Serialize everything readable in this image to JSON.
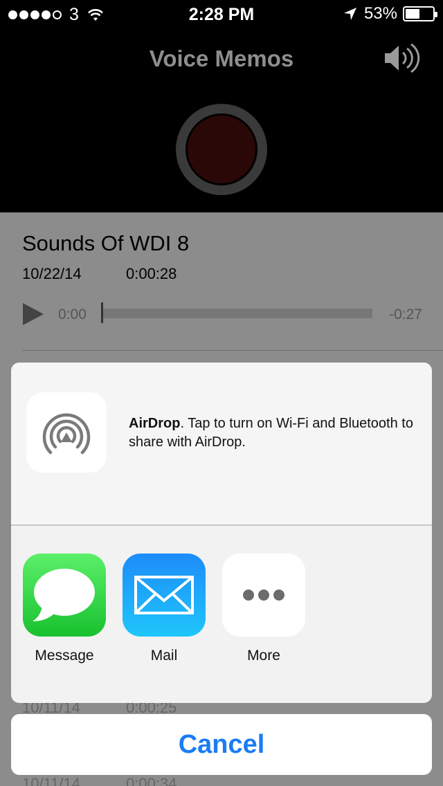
{
  "status_bar": {
    "carrier": "3",
    "time": "2:28 PM",
    "battery_percent": "53%",
    "battery_level": 0.53
  },
  "header": {
    "title": "Voice Memos"
  },
  "recording": {
    "name": "Sounds Of WDI 8",
    "date": "10/22/14",
    "duration": "0:00:28",
    "current_time": "0:00",
    "remaining_time": "-0:27",
    "progress": 0
  },
  "background_rows": [
    {
      "date": "10/11/14",
      "duration": "0:00:25"
    },
    {
      "date": "10/11/14",
      "duration": "0:00:34"
    }
  ],
  "share_sheet": {
    "airdrop_title": "AirDrop",
    "airdrop_text": ". Tap to turn on Wi-Fi and Bluetooth to share with AirDrop.",
    "apps": [
      {
        "label": "Message",
        "icon": "message-icon"
      },
      {
        "label": "Mail",
        "icon": "mail-icon"
      },
      {
        "label": "More",
        "icon": "more-icon"
      }
    ],
    "cancel_label": "Cancel"
  },
  "colors": {
    "accent": "#1a7cf5",
    "record_button": "#2a0808",
    "message_green": "#18c12e",
    "mail_blue": "#1d8cf9"
  }
}
